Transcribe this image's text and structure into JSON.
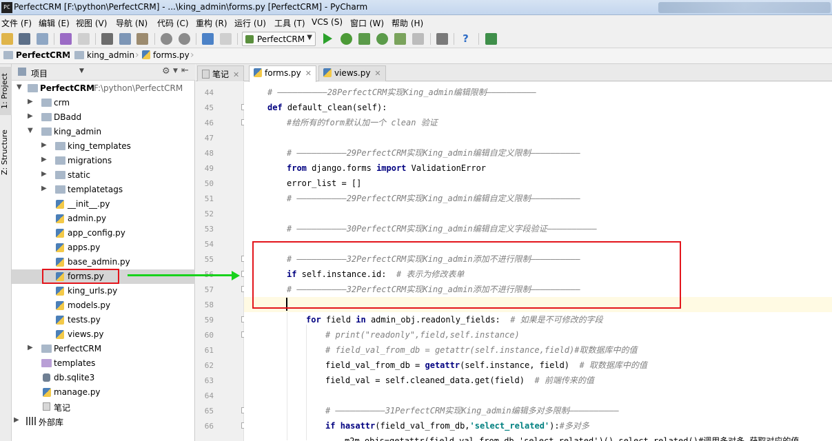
{
  "window": {
    "title": "PerfectCRM [F:\\python\\PerfectCRM] - ...\\king_admin\\forms.py [PerfectCRM] - PyCharm",
    "app_icon_text": "PC"
  },
  "menu": [
    "文件 (F)",
    "编辑 (E)",
    "视图 (V)",
    "导航 (N)",
    "代码 (C)",
    "重构 (R)",
    "运行 (U)",
    "工具 (T)",
    "VCS (S)",
    "窗口 (W)",
    "帮助 (H)"
  ],
  "toolbar": {
    "run_config": "PerfectCRM"
  },
  "breadcrumb": [
    "PerfectCRM",
    "king_admin",
    "forms.py"
  ],
  "side_tabs": [
    "1: Project",
    "Z: Structure"
  ],
  "project_panel": {
    "header": "项目",
    "root_label": "PerfectCRM",
    "root_path": "F:\\python\\PerfectCRM",
    "items": [
      {
        "label": "crm",
        "kind": "folder"
      },
      {
        "label": "DBadd",
        "kind": "folder"
      },
      {
        "label": "king_admin",
        "kind": "folder"
      },
      {
        "label": "king_templates",
        "kind": "folder"
      },
      {
        "label": "migrations",
        "kind": "folder"
      },
      {
        "label": "static",
        "kind": "folder"
      },
      {
        "label": "templatetags",
        "kind": "folder"
      },
      {
        "label": "__init__.py",
        "kind": "py"
      },
      {
        "label": "admin.py",
        "kind": "py"
      },
      {
        "label": "app_config.py",
        "kind": "py"
      },
      {
        "label": "apps.py",
        "kind": "py"
      },
      {
        "label": "base_admin.py",
        "kind": "py"
      },
      {
        "label": "forms.py",
        "kind": "py"
      },
      {
        "label": "king_urls.py",
        "kind": "py"
      },
      {
        "label": "models.py",
        "kind": "py"
      },
      {
        "label": "tests.py",
        "kind": "py"
      },
      {
        "label": "views.py",
        "kind": "py"
      },
      {
        "label": "PerfectCRM",
        "kind": "folder"
      },
      {
        "label": "templates",
        "kind": "template-folder"
      },
      {
        "label": "db.sqlite3",
        "kind": "sqlite"
      },
      {
        "label": "manage.py",
        "kind": "py"
      },
      {
        "label": "笔记",
        "kind": "notes"
      },
      {
        "label": "外部库",
        "kind": "libs"
      }
    ]
  },
  "editor_tabs": [
    {
      "label": "笔记",
      "active": false
    },
    {
      "label": "forms.py",
      "active": true
    },
    {
      "label": "views.py",
      "active": false
    }
  ],
  "code": {
    "line_numbers": [
      "44",
      "45",
      "46",
      "47",
      "48",
      "49",
      "50",
      "51",
      "52",
      "53",
      "54",
      "55",
      "56",
      "57",
      "58",
      "59",
      "60",
      "61",
      "62",
      "63",
      "64",
      "65",
      "66"
    ],
    "lines": {
      "l44": "# ——————————28PerfectCRM实现King_admin编辑限制——————————",
      "l45_kw": "def",
      "l45_rest": " default_clean(self):",
      "l46": "#给所有的form默认加一个 clean 验证",
      "l48": "# ——————————29PerfectCRM实现King_admin编辑自定义限制——————————",
      "l49_kw1": "from",
      "l49_mid": " django.forms ",
      "l49_kw2": "import",
      "l49_rest": " ValidationError",
      "l50": "error_list = []",
      "l51": "# ——————————29PerfectCRM实现King_admin编辑自定义限制——————————",
      "l53": "# ——————————30PerfectCRM实现King_admin编辑自定义字段验证——————————",
      "l55": "# ——————————32PerfectCRM实现King_admin添加不进行限制——————————",
      "l56_kw": "if",
      "l56_rest": " self.instance.id:  ",
      "l56_cm": "# 表示为修改表单",
      "l57": "# ——————————32PerfectCRM实现King_admin添加不进行限制——————————",
      "l59_kw1": "for",
      "l59_mid": " field ",
      "l59_kw2": "in",
      "l59_rest": " admin_obj.readonly_fields:  ",
      "l59_cm": "# 如果是不可修改的字段",
      "l60": "# print(\"readonly\",field,self.instance)",
      "l61": "# field_val_from_db = getattr(self.instance,field)#取数据库中的值",
      "l62_a": "field_val_from_db = ",
      "l62_kw": "getattr",
      "l62_b": "(self.instance, field)  ",
      "l62_cm": "# 取数据库中的值",
      "l63_a": "field_val = self.cleaned_data.get(field)  ",
      "l63_cm": "# 前端传来的值",
      "l65": "# ——————————31PerfectCRM实现King_admin编辑多对多限制——————————",
      "l66_kw": "if",
      "l66_a": " ",
      "l66_fn": "hasattr",
      "l66_b": "(field_val_from_db,",
      "l66_st": "'select_related'",
      "l66_c": "):",
      "l66_cm": "#多对多",
      "l67": "m2m_objs=getattr(field_val_from_db,'select_related')().select_related()#调用多对多,获取对应的值"
    }
  },
  "colors": {
    "keyword": "#000080",
    "comment": "#808080",
    "string": "#008080",
    "annotation_box": "#e3141b",
    "annotation_arrow": "#18d21c"
  }
}
